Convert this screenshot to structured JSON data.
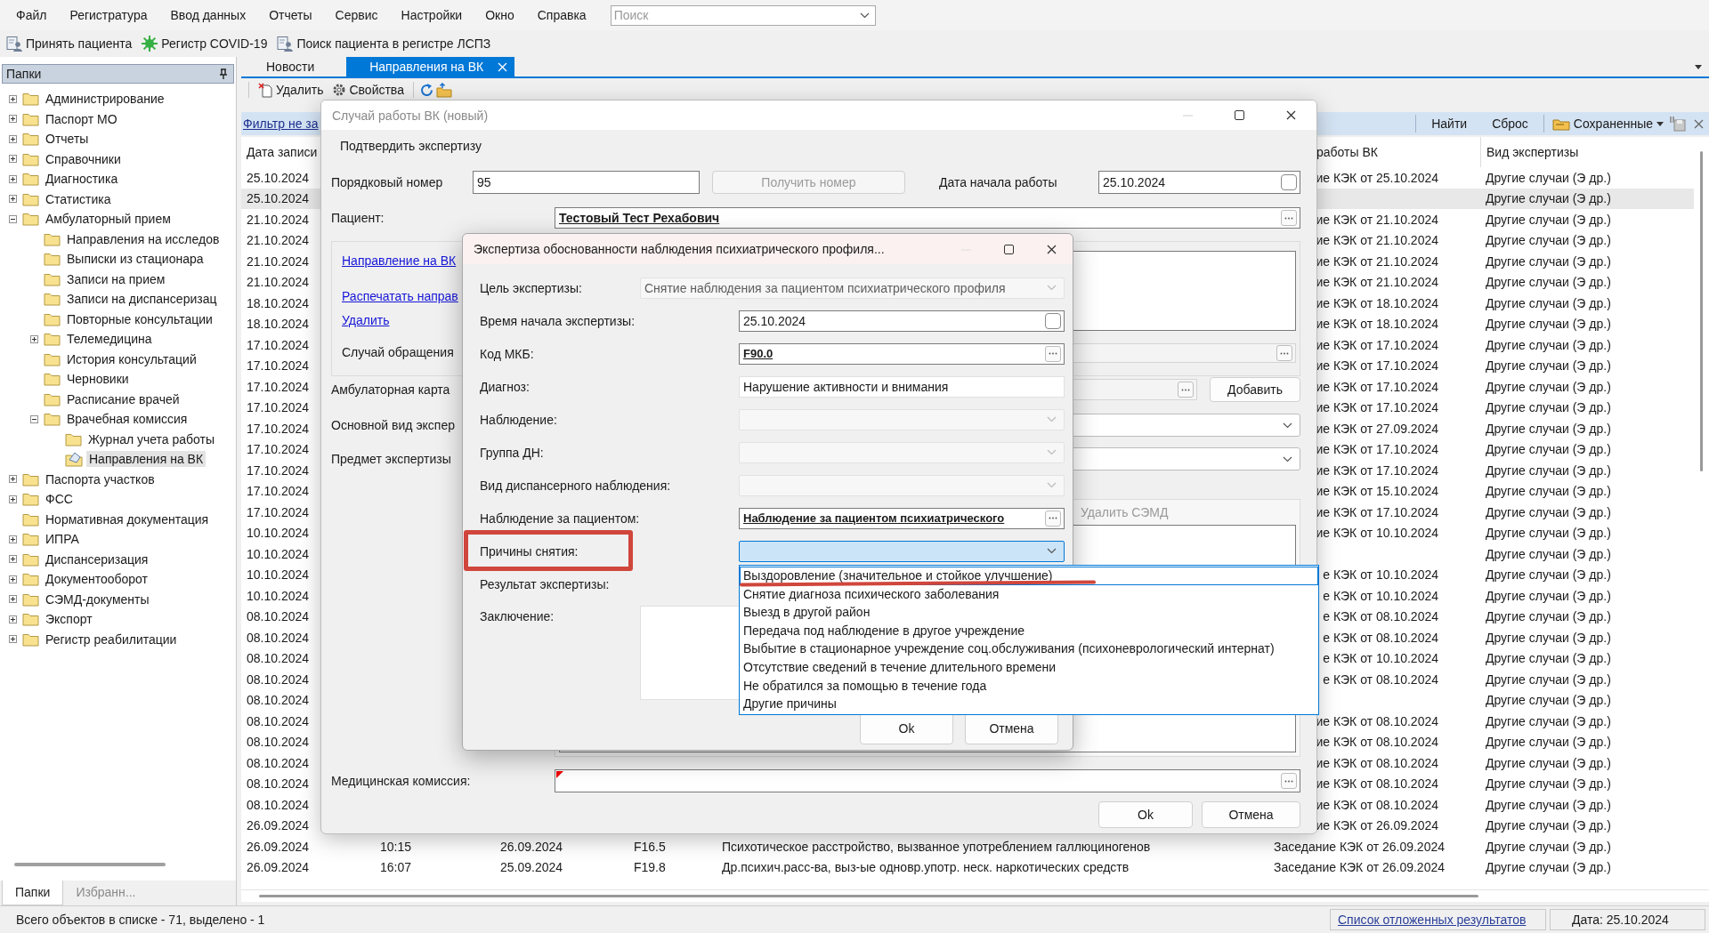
{
  "menu": [
    "Файл",
    "Регистратура",
    "Ввод данных",
    "Отчеты",
    "Сервис",
    "Настройки",
    "Окно",
    "Справка"
  ],
  "search": {
    "placeholder": "Поиск"
  },
  "toolbar": [
    "Принять пациента",
    "Регистр COVID-19",
    "Поиск пациента в регистре ЛСПЗ"
  ],
  "folders": {
    "title": "Папки",
    "tree": [
      {
        "label": "Администрирование",
        "expanded": false,
        "selected": false
      },
      {
        "label": "Паспорт МО",
        "expanded": false,
        "selected": false
      },
      {
        "label": "Отчеты",
        "expanded": false,
        "selected": false
      },
      {
        "label": "Справочники",
        "expanded": false,
        "selected": false
      },
      {
        "label": "Диагностика",
        "expanded": false,
        "selected": false
      },
      {
        "label": "Статистика",
        "expanded": false,
        "selected": false
      },
      {
        "label": "Амбулаторный прием",
        "expanded": true,
        "selected": false,
        "children": [
          {
            "label": "Направления на исследов",
            "selected": false
          },
          {
            "label": "Выписки из стационара",
            "selected": false
          },
          {
            "label": "Записи на прием",
            "selected": false
          },
          {
            "label": "Записи на диспансеризац",
            "selected": false
          },
          {
            "label": "Повторные консультации",
            "selected": false
          },
          {
            "label": "Телемедицина",
            "expanded": false,
            "selected": false
          },
          {
            "label": "История консультаций",
            "selected": false
          },
          {
            "label": "Черновики",
            "selected": false
          },
          {
            "label": "Расписание врачей",
            "selected": false
          },
          {
            "label": "Врачебная комиссия",
            "expanded": true,
            "selected": false,
            "children": [
              {
                "label": "Журнал учета работы",
                "selected": false
              },
              {
                "label": "Направления на ВК",
                "selected": true
              }
            ]
          }
        ]
      },
      {
        "label": "Паспорта участков",
        "expanded": false,
        "selected": false
      },
      {
        "label": "ФСС",
        "expanded": false,
        "selected": false
      },
      {
        "label": "Нормативная документация",
        "selected": false
      },
      {
        "label": "ИПРА",
        "expanded": false,
        "selected": false
      },
      {
        "label": "Диспансеризация",
        "expanded": false,
        "selected": false
      },
      {
        "label": "Документооборот",
        "expanded": false,
        "selected": false
      },
      {
        "label": "СЭМД-документы",
        "expanded": false,
        "selected": false
      },
      {
        "label": "Экспорт",
        "expanded": false,
        "selected": false
      },
      {
        "label": "Регистр реабилитации",
        "expanded": false,
        "selected": false
      }
    ],
    "bottom_tabs": [
      {
        "label": "Папки",
        "selected": true
      },
      {
        "label": "Избранн...",
        "selected": false
      }
    ]
  },
  "doc_tabs": [
    {
      "label": "Новости",
      "selected": false
    },
    {
      "label": "Направления на ВК",
      "selected": true
    }
  ],
  "list_toolbar": [
    "Удалить",
    "Свойства"
  ],
  "filter_bar": {
    "filter_link": "Фильтр не за",
    "buttons": [
      "Найти",
      "Сброс"
    ],
    "saved": "Сохраненные"
  },
  "table": {
    "columns": [
      "Дата записи",
      "работы ВК",
      "Вид экспертизы"
    ],
    "rows": [
      {
        "date": "25.10.2024",
        "work_vk": "ие КЭК от 25.10.2024",
        "exam_type": "Другие случаи (Э др.)",
        "selected": false
      },
      {
        "date": "25.10.2024",
        "exam_type": "Другие случаи (Э др.)",
        "selected": true
      },
      {
        "date": "21.10.2024",
        "work_vk": "ие КЭК от 21.10.2024",
        "exam_type": "Другие случаи (Э др.)",
        "selected": false
      },
      {
        "date": "21.10.2024",
        "work_vk": "ие КЭК от 21.10.2024",
        "exam_type": "Другие случаи (Э др.)",
        "selected": false
      },
      {
        "date": "21.10.2024",
        "work_vk": "ие КЭК от 21.10.2024",
        "exam_type": "Другие случаи (Э др.)",
        "selected": false
      },
      {
        "date": "21.10.2024",
        "work_vk": "ие КЭК от 21.10.2024",
        "exam_type": "Другие случаи (Э др.)",
        "selected": false
      },
      {
        "date": "18.10.2024",
        "work_vk": "ие КЭК от 18.10.2024",
        "exam_type": "Другие случаи (Э др.)",
        "selected": false
      },
      {
        "date": "18.10.2024",
        "work_vk": "ие КЭК от 18.10.2024",
        "exam_type": "Другие случаи (Э др.)",
        "selected": false
      },
      {
        "date": "17.10.2024",
        "work_vk": "ие КЭК от 17.10.2024",
        "exam_type": "Другие случаи (Э др.)",
        "selected": false
      },
      {
        "date": "17.10.2024",
        "work_vk": "ие КЭК от 17.10.2024",
        "exam_type": "Другие случаи (Э др.)",
        "selected": false
      },
      {
        "date": "17.10.2024",
        "work_vk": "ие КЭК от 17.10.2024",
        "exam_type": "Другие случаи (Э др.)",
        "selected": false
      },
      {
        "date": "17.10.2024",
        "work_vk": "ие КЭК от 17.10.2024",
        "exam_type": "Другие случаи (Э др.)",
        "selected": false
      },
      {
        "date": "17.10.2024",
        "work_vk": "ие КЭК от 27.09.2024",
        "exam_type": "Другие случаи (Э др.)",
        "selected": false
      },
      {
        "date": "17.10.2024",
        "work_vk": "ие КЭК от 17.10.2024",
        "exam_type": "Другие случаи (Э др.)",
        "selected": false
      },
      {
        "date": "17.10.2024",
        "work_vk": "ие КЭК от 17.10.2024",
        "exam_type": "Другие случаи (Э др.)",
        "selected": false
      },
      {
        "date": "17.10.2024",
        "work_vk": "ие КЭК от 15.10.2024",
        "exam_type": "Другие случаи (Э др.)",
        "selected": false
      },
      {
        "date": "17.10.2024",
        "work_vk": "ие КЭК от 17.10.2024",
        "exam_type": "Другие случаи (Э др.)",
        "selected": false
      },
      {
        "date": "10.10.2024",
        "work_vk": "ие КЭК от 10.10.2024",
        "exam_type": "Другие случаи (Э др.)",
        "selected": false
      },
      {
        "date": "10.10.2024",
        "exam_type": "Другие случаи (Э др.)",
        "selected": false
      },
      {
        "date": "10.10.2024",
        "work_vk": "е КЭК от 10.10.2024",
        "exam_type": "Другие случаи (Э др.)",
        "selected": false
      },
      {
        "date": "10.10.2024",
        "work_vk": "е КЭК от 10.10.2024",
        "exam_type": "Другие случаи (Э др.)",
        "selected": false
      },
      {
        "date": "08.10.2024",
        "work_vk": "е КЭК от 08.10.2024",
        "exam_type": "Другие случаи (Э др.)",
        "selected": false
      },
      {
        "date": "08.10.2024",
        "work_vk": "е КЭК от 08.10.2024",
        "exam_type": "Другие случаи (Э др.)",
        "selected": false
      },
      {
        "date": "08.10.2024",
        "work_vk": "е КЭК от 10.10.2024",
        "exam_type": "Другие случаи (Э др.)",
        "selected": false
      },
      {
        "date": "08.10.2024",
        "work_vk": "е КЭК от 08.10.2024",
        "exam_type": "Другие случаи (Э др.)",
        "selected": false
      },
      {
        "date": "08.10.2024",
        "exam_type": "Другие случаи (Э др.)",
        "selected": false
      },
      {
        "date": "08.10.2024",
        "work_vk": "ие КЭК от 08.10.2024",
        "exam_type": "Другие случаи (Э др.)",
        "selected": false
      },
      {
        "date": "08.10.2024",
        "work_vk": "ие КЭК от 08.10.2024",
        "exam_type": "Другие случаи (Э др.)",
        "selected": false
      },
      {
        "date": "08.10.2024",
        "work_vk": "ие КЭК от 08.10.2024",
        "exam_type": "Другие случаи (Э др.)",
        "selected": false
      },
      {
        "date": "08.10.2024",
        "work_vk": "ие КЭК от 08.10.2024",
        "exam_type": "Другие случаи (Э др.)",
        "selected": false
      },
      {
        "date": "08.10.2024",
        "work_vk": "ие КЭК от 08.10.2024",
        "exam_type": "Другие случаи (Э др.)",
        "selected": false
      },
      {
        "date": "26.09.2024",
        "work_vk": "ие КЭК от 26.09.2024",
        "exam_type": "Другие случаи (Э др.)",
        "selected": false
      },
      {
        "date": "26.09.2024",
        "time": "10:15",
        "date_2": "26.09.2024",
        "code": "F16.5",
        "diagnosis": "Психотическое расстройство, вызванное употреблением галлюциногенов",
        "work_vk": "Заседание КЭК от 26.09.2024",
        "exam_type": "Другие случаи (Э др.)",
        "selected": false
      },
      {
        "date": "26.09.2024",
        "time": "16:07",
        "date_2": "25.09.2024",
        "code": "F19.8",
        "diagnosis": "Др.психич.расс-ва, выз-ые одновр.употр. неск. наркотических средств",
        "work_vk": "Заседание КЭК от 26.09.2024",
        "exam_type": "Другие случаи (Э др.)",
        "selected": false
      }
    ]
  },
  "status_bar": {
    "summary": "Всего объектов в списке - 71, выделено - 1",
    "link": "Список отложенных результатов",
    "date": "Дата: 25.10.2024"
  },
  "case_dialog": {
    "title": "Случай работы ВК (новый)",
    "action": "Подтвердить экспертизу",
    "number_label": "Порядковый номер",
    "number_value": "95",
    "get_number_button": {
      "label": "Получить номер",
      "disabled": true
    },
    "start_date_label": "Дата начала работы",
    "start_date_value": "25.10.2024",
    "patient_label": "Пациент:",
    "patient_value": "Тестовый Тест Рехабович",
    "links": [
      "Направление на ВК",
      "Распечатать направ",
      "Удалить"
    ],
    "appeal_label": "Случай обращения",
    "card_label": "Амбулаторная карта",
    "add_button": "Добавить",
    "main_type_label": "Основной вид экспер",
    "subject_label": "Предмет экспертизы",
    "delete_semd_button": {
      "label": "Удалить СЭМД",
      "disabled": true
    },
    "commission_label": "Медицинская комиссия:",
    "buttons": [
      "Ok",
      "Отмена"
    ]
  },
  "expertise_dialog": {
    "title": "Экспертиза обоснованности наблюдения психиатрического профиля...",
    "rows": [
      {
        "label": "Цель экспертизы:",
        "kind": "combo",
        "value": "Снятие наблюдения за пациентом психиатрического профиля",
        "disabled": true
      },
      {
        "label": "Время начала экспертизы:",
        "kind": "date",
        "value": "25.10.2024"
      },
      {
        "label": "Код МКБ:",
        "kind": "lookup",
        "value": "F90.0"
      },
      {
        "label": "Диагноз:",
        "kind": "text",
        "value": "Нарушение активности и внимания"
      },
      {
        "label": "Наблюдение:",
        "kind": "combo",
        "disabled": true
      },
      {
        "label": "Группа ДН:",
        "kind": "combo",
        "disabled": true
      },
      {
        "label": "Вид диспансерного наблюдения:",
        "kind": "combo",
        "disabled": true
      },
      {
        "label": "Наблюдение за пациентом:",
        "kind": "lookup",
        "value": "Наблюдение за пациентом психиатрического"
      },
      {
        "label": "Причины снятия:",
        "kind": "combo",
        "disabled": false,
        "expanded": true,
        "options": [
          {
            "label": "Выздоровление (значительное и стойкое улучшение)",
            "selected": true
          },
          {
            "label": "Снятие диагноза психического заболевания",
            "selected": false
          },
          {
            "label": "Выезд в другой район",
            "selected": false
          },
          {
            "label": "Передача под наблюдение в другое учреждение",
            "selected": false
          },
          {
            "label": "Выбытие в стационарное учреждение соц.обслуживания (психоневрологический интернат)",
            "selected": false
          },
          {
            "label": "Отсутствие сведений в течение длительного времени",
            "selected": false
          },
          {
            "label": "Не обратился за помощью в течение года",
            "selected": false
          },
          {
            "label": "Другие причины",
            "selected": false
          }
        ]
      },
      {
        "label": "Результат экспертизы:",
        "kind": "none"
      },
      {
        "label": "Заключение:",
        "kind": "memo"
      }
    ],
    "buttons": [
      "Ok",
      "Отмена"
    ]
  }
}
